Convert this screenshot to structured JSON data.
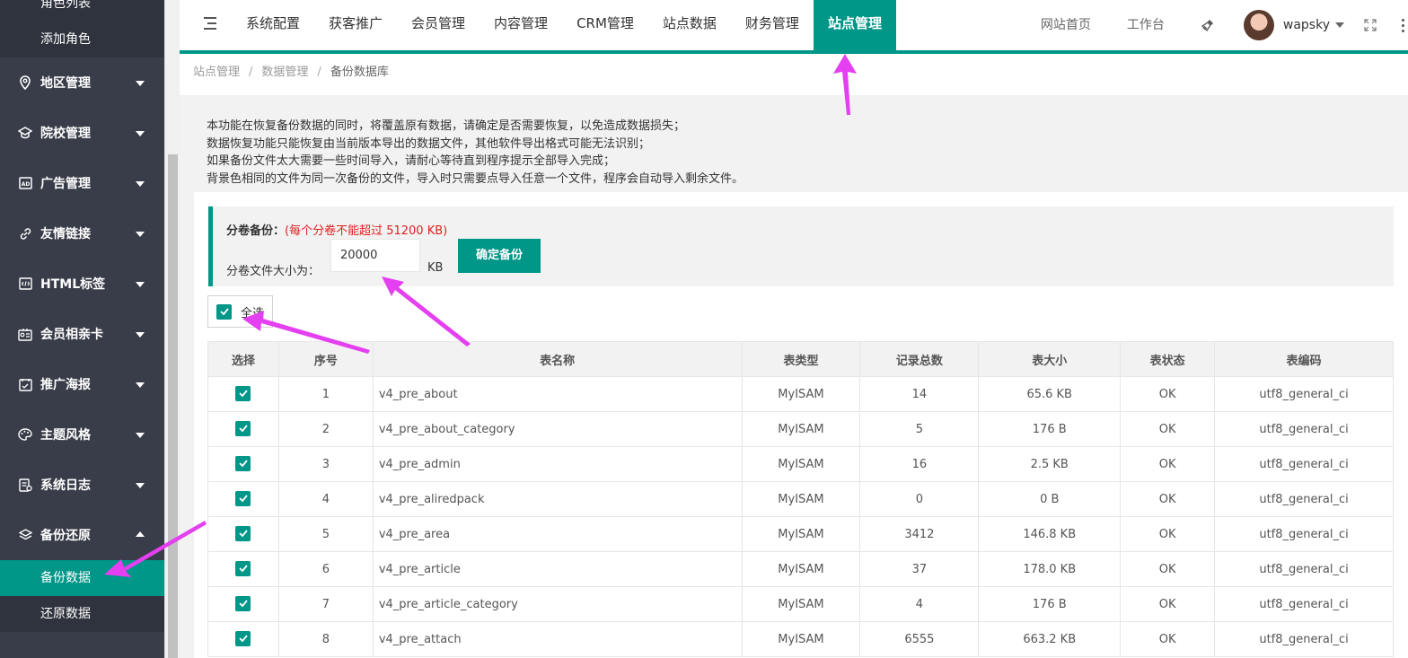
{
  "sidebar": {
    "top_sub": "角色列表",
    "sub_add_role": "添加角色",
    "items": [
      {
        "label": "地区管理",
        "icon": "location-icon"
      },
      {
        "label": "院校管理",
        "icon": "school-icon"
      },
      {
        "label": "广告管理",
        "icon": "ad-icon"
      },
      {
        "label": "友情链接",
        "icon": "link-icon"
      },
      {
        "label": "HTML标签",
        "icon": "html-icon"
      },
      {
        "label": "会员相亲卡",
        "icon": "member-card-icon"
      },
      {
        "label": "推广海报",
        "icon": "poster-icon"
      },
      {
        "label": "主题风格",
        "icon": "palette-icon"
      },
      {
        "label": "系统日志",
        "icon": "log-icon"
      },
      {
        "label": "备份还原",
        "icon": "layers-icon"
      }
    ],
    "backup_sub": [
      "备份数据",
      "还原数据"
    ]
  },
  "header": {
    "nav": [
      "系统配置",
      "获客推广",
      "会员管理",
      "内容管理",
      "CRM管理",
      "站点数据",
      "财务管理",
      "站点管理"
    ],
    "active_nav": "站点管理",
    "right_links": [
      "网站首页",
      "工作台"
    ],
    "username": "wapsky"
  },
  "breadcrumb": [
    "站点管理",
    "数据管理",
    "备份数据库"
  ],
  "info_lines": [
    "本功能在恢复备份数据的同时，将覆盖原有数据，请确定是否需要恢复，以免造成数据损失；",
    "数据恢复功能只能恢复由当前版本导出的数据文件，其他软件导出格式可能无法识别；",
    "如果备份文件太大需要一些时间导入，请耐心等待直到程序提示全部导入完成；",
    "背景色相同的文件为同一次备份的文件，导入时只需要点导入任意一个文件，程序会自动导入剩余文件。"
  ],
  "backup": {
    "title": "分卷备份：",
    "note": "(每个分卷不能超过 51200 KB)",
    "size_label": "分卷文件大小为：",
    "size_value": "20000",
    "unit": "KB",
    "confirm": "确定备份",
    "select_all": "全选"
  },
  "table": {
    "headers": [
      "选择",
      "序号",
      "表名称",
      "表类型",
      "记录总数",
      "表大小",
      "表状态",
      "表编码"
    ],
    "rows": [
      {
        "no": "1",
        "name": "v4_pre_about",
        "type": "MyISAM",
        "count": "14",
        "size": "65.6 KB",
        "status": "OK",
        "charset": "utf8_general_ci"
      },
      {
        "no": "2",
        "name": "v4_pre_about_category",
        "type": "MyISAM",
        "count": "5",
        "size": "176 B",
        "status": "OK",
        "charset": "utf8_general_ci"
      },
      {
        "no": "3",
        "name": "v4_pre_admin",
        "type": "MyISAM",
        "count": "16",
        "size": "2.5 KB",
        "status": "OK",
        "charset": "utf8_general_ci"
      },
      {
        "no": "4",
        "name": "v4_pre_aliredpack",
        "type": "MyISAM",
        "count": "0",
        "size": "0 B",
        "status": "OK",
        "charset": "utf8_general_ci"
      },
      {
        "no": "5",
        "name": "v4_pre_area",
        "type": "MyISAM",
        "count": "3412",
        "size": "146.8 KB",
        "status": "OK",
        "charset": "utf8_general_ci"
      },
      {
        "no": "6",
        "name": "v4_pre_article",
        "type": "MyISAM",
        "count": "37",
        "size": "178.0 KB",
        "status": "OK",
        "charset": "utf8_general_ci"
      },
      {
        "no": "7",
        "name": "v4_pre_article_category",
        "type": "MyISAM",
        "count": "4",
        "size": "176 B",
        "status": "OK",
        "charset": "utf8_general_ci"
      },
      {
        "no": "8",
        "name": "v4_pre_attach",
        "type": "MyISAM",
        "count": "6555",
        "size": "663.2 KB",
        "status": "OK",
        "charset": "utf8_general_ci"
      }
    ]
  },
  "colors": {
    "accent": "#009688",
    "sidebar": "#393d49",
    "annotation": "#e43ff0",
    "warning": "#e02020"
  }
}
